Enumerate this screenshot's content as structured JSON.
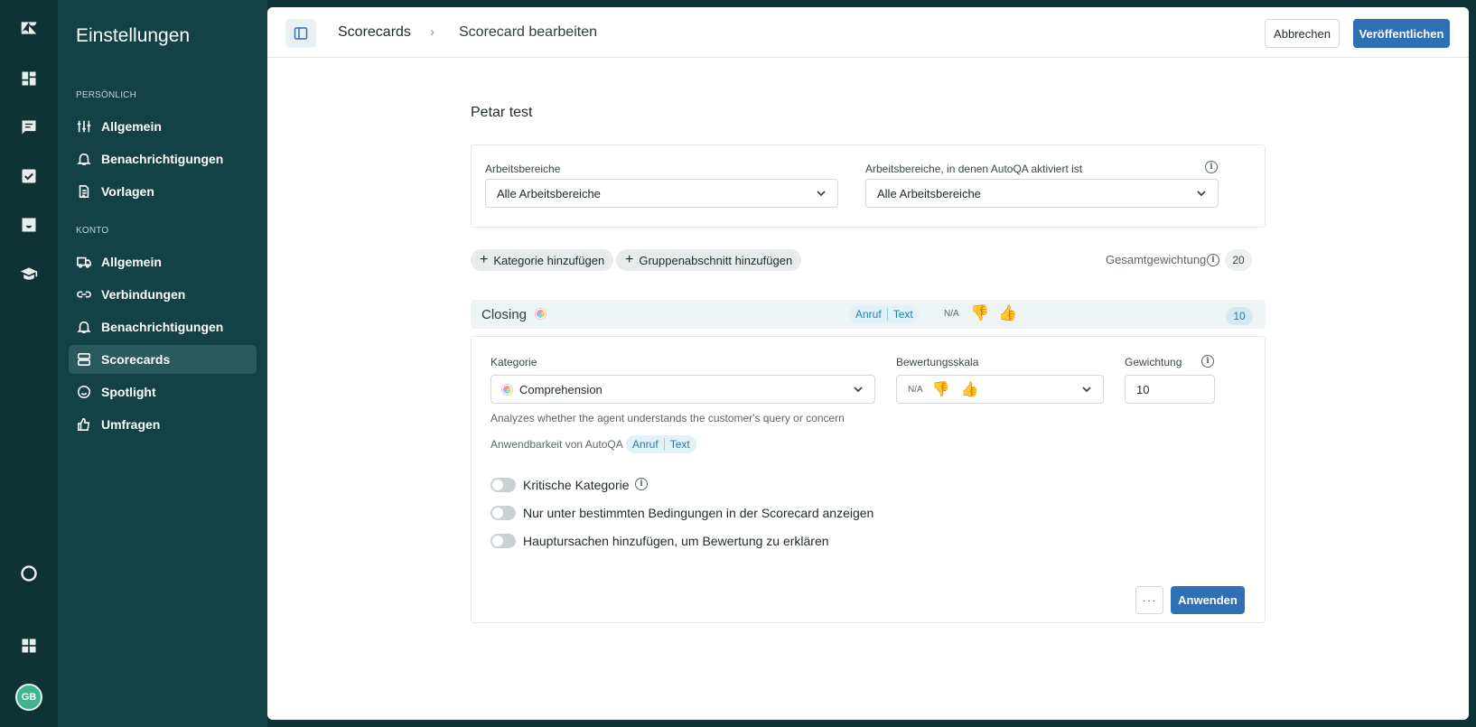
{
  "rail": {
    "icons": [
      "zendesk-logo-icon",
      "dashboard-icon",
      "conversations-icon",
      "tasks-icon",
      "inbox-icon",
      "academy-icon",
      "help-icon",
      "apps-icon"
    ],
    "avatar_initials": "GB",
    "avatar_color": "#3fb58f"
  },
  "sidebar": {
    "title": "Einstellungen",
    "section_personal": "PERSÖNLICH",
    "personal_items": [
      {
        "label": "Allgemein",
        "icon": "sliders-icon"
      },
      {
        "label": "Benachrichtigungen",
        "icon": "bell-icon"
      },
      {
        "label": "Vorlagen",
        "icon": "document-icon"
      }
    ],
    "section_account": "KONTO",
    "account_items": [
      {
        "label": "Allgemein",
        "icon": "truck-icon"
      },
      {
        "label": "Verbindungen",
        "icon": "link-icon"
      },
      {
        "label": "Benachrichtigungen",
        "icon": "bell-icon"
      },
      {
        "label": "Scorecards",
        "icon": "scorecard-icon",
        "active": true
      },
      {
        "label": "Spotlight",
        "icon": "smiley-icon"
      },
      {
        "label": "Umfragen",
        "icon": "thumbs-up-icon"
      }
    ]
  },
  "header": {
    "breadcrumb_root": "Scorecards",
    "breadcrumb_sep": "›",
    "breadcrumb_current": "Scorecard bearbeiten",
    "cancel_label": "Abbrechen",
    "publish_label": "Veröffentlichen",
    "accent": "#2f6fb3"
  },
  "scorecard": {
    "name": "Petar test",
    "workspaces_label": "Arbeitsbereiche",
    "workspaces_value": "Alle Arbeitsbereiche",
    "autoqa_workspaces_label": "Arbeitsbereiche, in denen AutoQA aktiviert ist",
    "autoqa_workspaces_value": "Alle Arbeitsbereiche",
    "add_category_label": "Kategorie hinzufügen",
    "add_group_label": "Gruppenabschnitt hinzufügen",
    "total_weight_label": "Gesamtgewichtung",
    "total_weight_value": "20"
  },
  "category_row": {
    "name": "Closing",
    "tag_call": "Anruf",
    "tag_text": "Text",
    "na_label": "N/A",
    "thumb_down": "👎",
    "thumb_up": "👍",
    "weight": "10"
  },
  "detail": {
    "category_label": "Kategorie",
    "category_value": "Comprehension",
    "rating_scale_label": "Bewertungsskala",
    "rating_na": "N/A",
    "thumb_down": "👎",
    "thumb_up": "👍",
    "weight_label": "Gewichtung",
    "weight_value": "10",
    "description": "Analyzes whether the agent understands the customer's query or concern",
    "autoqa_label": "Anwendbarkeit von AutoQA",
    "tag_call": "Anruf",
    "tag_text": "Text",
    "toggle_critical": "Kritische Kategorie",
    "toggle_conditions": "Nur unter bestimmten Bedingungen in der Scorecard anzeigen",
    "toggle_root_causes": "Hauptursachen hinzufügen, um Bewertung zu erklären",
    "more_label": "···",
    "apply_label": "Anwenden"
  }
}
